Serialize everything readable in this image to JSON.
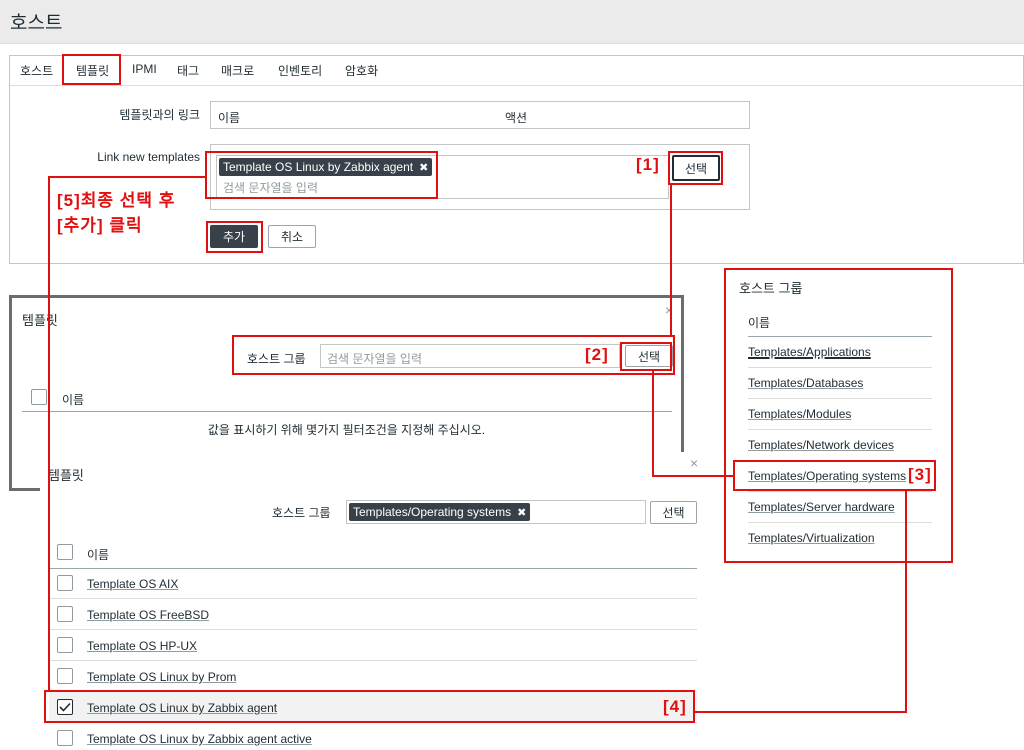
{
  "page": {
    "title": "호스트"
  },
  "tabs": [
    "호스트",
    "템플릿",
    "IPMI",
    "태그",
    "매크로",
    "인벤토리",
    "암호화"
  ],
  "form": {
    "linked_label": "템플릿과의 링크",
    "col_name": "이름",
    "col_action": "액션",
    "link_new_label": "Link new templates",
    "selected_template": "Template OS Linux by Zabbix agent",
    "search_placeholder": "검색 문자열을 입력",
    "select_button": "선택",
    "add_button": "추가",
    "cancel_button": "취소"
  },
  "annotations": {
    "step1": "[1]",
    "step2": "[2]",
    "step3": "[3]",
    "step4": "[4]",
    "step5_line1": "[5]최종 선택 후",
    "step5_line2": "[추가] 클릭"
  },
  "popup1": {
    "title": "템플릿",
    "host_group_label": "호스트 그룹",
    "search_placeholder": "검색 문자열을 입력",
    "select_button": "선택",
    "col_name": "이름",
    "empty_message": "값을 표시하기 위해 몇가지 필터조건을 지정해 주십시오.",
    "close": "×"
  },
  "popup2": {
    "title": "템플릿",
    "host_group_label": "호스트 그룹",
    "selected_group": "Templates/Operating systems",
    "select_button": "선택",
    "col_name": "이름",
    "close": "×",
    "templates": [
      {
        "name": "Template OS AIX",
        "checked": false
      },
      {
        "name": "Template OS FreeBSD",
        "checked": false
      },
      {
        "name": "Template OS HP-UX",
        "checked": false
      },
      {
        "name": "Template OS Linux by Prom",
        "checked": false
      },
      {
        "name": "Template OS Linux by Zabbix agent",
        "checked": true
      },
      {
        "name": "Template OS Linux by Zabbix agent active",
        "checked": false
      }
    ]
  },
  "host_groups": {
    "title": "호스트 그룹",
    "col_name": "이름",
    "items": [
      "Templates/Applications",
      "Templates/Databases",
      "Templates/Modules",
      "Templates/Network devices",
      "Templates/Operating systems",
      "Templates/Server hardware",
      "Templates/Virtualization"
    ]
  },
  "colors": {
    "accent_red": "#e01010",
    "chip_bg": "#384149",
    "header_bg": "#ebebeb"
  }
}
